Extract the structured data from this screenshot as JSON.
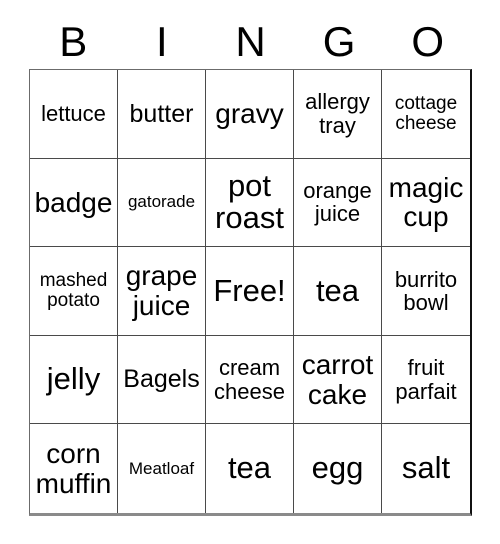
{
  "header": {
    "letters": [
      "B",
      "I",
      "N",
      "G",
      "O"
    ]
  },
  "grid": {
    "rows": 5,
    "columns": 5,
    "free_space_label": "Free!",
    "cells": [
      {
        "label": "lettuce",
        "size": "sm"
      },
      {
        "label": "butter",
        "size": "md"
      },
      {
        "label": "gravy",
        "size": "lg"
      },
      {
        "label": "allergy\ntray",
        "size": "sm"
      },
      {
        "label": "cottage\ncheese",
        "size": "xs"
      },
      {
        "label": "badge",
        "size": "lg"
      },
      {
        "label": "gatorade",
        "size": "xxs"
      },
      {
        "label": "pot\nroast",
        "size": "xl"
      },
      {
        "label": "orange\njuice",
        "size": "sm"
      },
      {
        "label": "magic\ncup",
        "size": "lg"
      },
      {
        "label": "mashed\npotato",
        "size": "xs"
      },
      {
        "label": "grape\njuice",
        "size": "lg"
      },
      {
        "label": "Free!",
        "size": "xl"
      },
      {
        "label": "tea",
        "size": "xl"
      },
      {
        "label": "burrito\nbowl",
        "size": "sm"
      },
      {
        "label": "jelly",
        "size": "xl"
      },
      {
        "label": "Bagels",
        "size": "md"
      },
      {
        "label": "cream\ncheese",
        "size": "sm"
      },
      {
        "label": "carrot\ncake",
        "size": "lg"
      },
      {
        "label": "fruit\nparfait",
        "size": "sm"
      },
      {
        "label": "corn\nmuffin",
        "size": "lg"
      },
      {
        "label": "Meatloaf",
        "size": "xxs"
      },
      {
        "label": "tea",
        "size": "xl"
      },
      {
        "label": "egg",
        "size": "xl"
      },
      {
        "label": "salt",
        "size": "xl"
      }
    ]
  },
  "colors": {
    "background": "#ffffff",
    "text": "#000000",
    "grid_line": "#4a4a4a",
    "outer_border": "#6b6b6b"
  }
}
